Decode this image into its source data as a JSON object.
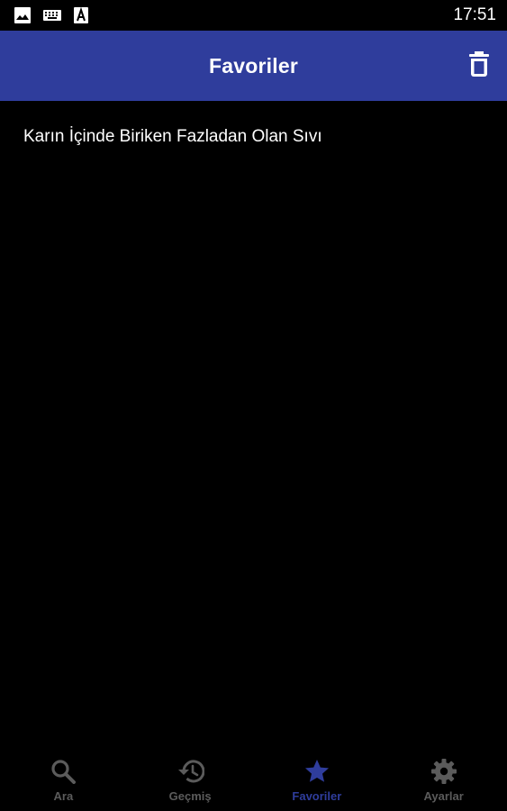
{
  "status_bar": {
    "time": "17:51",
    "icons": [
      "image-icon",
      "keyboard-icon",
      "a-icon"
    ]
  },
  "app_bar": {
    "title": "Favoriler",
    "action_icon": "trash-icon",
    "background": "#2f3d9c"
  },
  "favorites": [
    {
      "label": "Karın İçinde Biriken Fazladan Olan Sıvı"
    }
  ],
  "bottom_nav": {
    "items": [
      {
        "label": "Ara",
        "icon": "search-icon",
        "active": false
      },
      {
        "label": "Geçmiş",
        "icon": "history-icon",
        "active": false
      },
      {
        "label": "Favoriler",
        "icon": "star-icon",
        "active": true
      },
      {
        "label": "Ayarlar",
        "icon": "gear-icon",
        "active": false
      }
    ],
    "active_color": "#2f3d9c",
    "inactive_color": "#5b5b5b"
  }
}
